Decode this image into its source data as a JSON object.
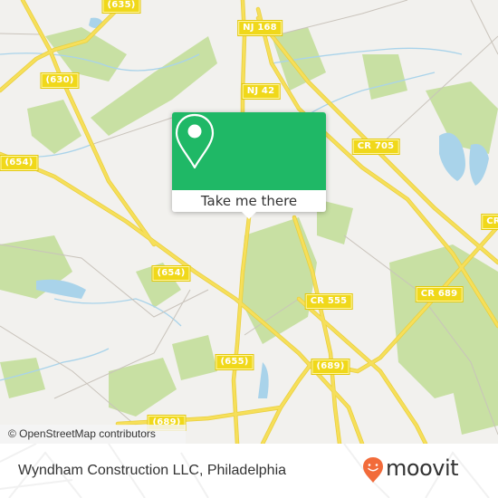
{
  "map": {
    "attribution": "© OpenStreetMap contributors",
    "road_labels": [
      {
        "id": "cr-635",
        "text": "(635)"
      },
      {
        "id": "nj-168",
        "text": "NJ 168"
      },
      {
        "id": "cr-630",
        "text": "(630)"
      },
      {
        "id": "nj-42",
        "text": "NJ 42"
      },
      {
        "id": "cr-705",
        "text": "CR 705"
      },
      {
        "id": "cr-654-left",
        "text": "(654)"
      },
      {
        "id": "cr-partial-right",
        "text": "CR"
      },
      {
        "id": "cr-654-center",
        "text": "(654)"
      },
      {
        "id": "cr-689-right",
        "text": "CR 689"
      },
      {
        "id": "cr-555",
        "text": "CR 555"
      },
      {
        "id": "cr-655",
        "text": "(655)"
      },
      {
        "id": "cr-689-center",
        "text": "(689)"
      },
      {
        "id": "cr-689-bottom",
        "text": "(689)"
      }
    ],
    "colors": {
      "land": "#f2f1ee",
      "wood": "#c8e0a3",
      "water": "#a9d3ea",
      "road": "#f6df5a",
      "minor_road": "#c9c3bb"
    }
  },
  "popup": {
    "button_label": "Take me there",
    "icon": "map-pin-icon",
    "color": "#1fb866"
  },
  "footer": {
    "place_name": "Wyndham Construction LLC, Philadelphia",
    "logo_text": "moovit",
    "logo_color": "#f26b3a"
  }
}
